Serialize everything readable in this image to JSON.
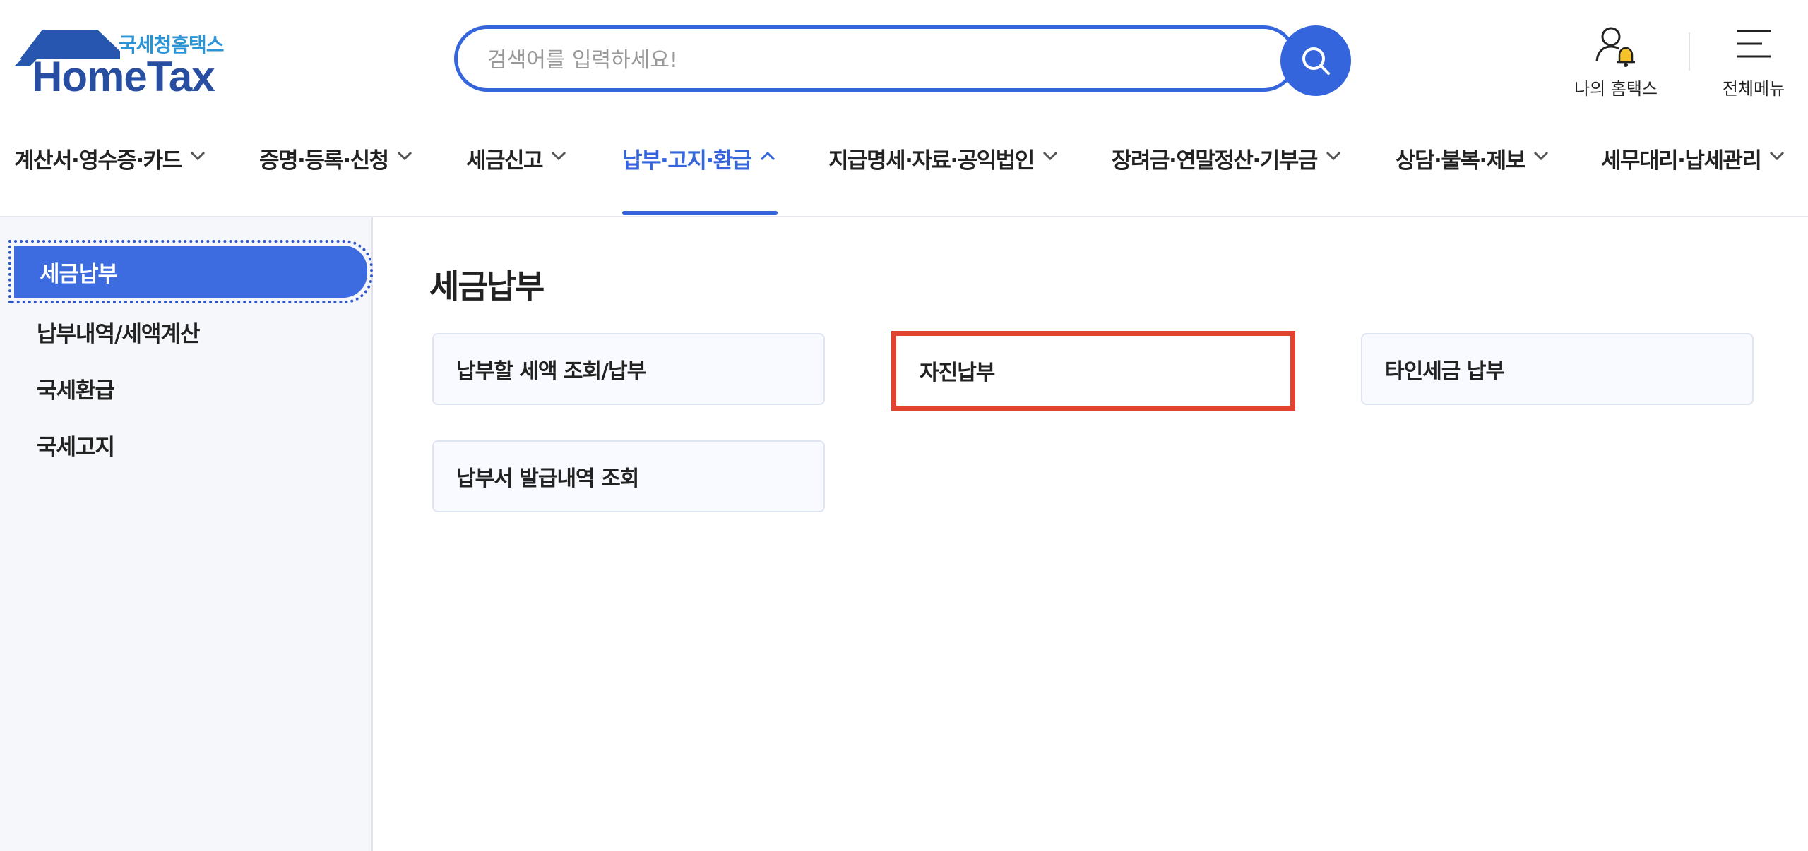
{
  "header": {
    "logo_korean": "국세청홈택스",
    "logo_english": "HomeTax",
    "search": {
      "placeholder": "검색어를 입력하세요!",
      "value": ""
    },
    "my_hometax_label": "나의 홈택스",
    "all_menu_label": "전체메뉴"
  },
  "gnb": {
    "items": [
      {
        "label": "계산서·영수증·카드"
      },
      {
        "label": "증명·등록·신청"
      },
      {
        "label": "세금신고"
      },
      {
        "label": "납부·고지·환급",
        "active": true
      },
      {
        "label": "지급명세·자료·공익법인"
      },
      {
        "label": "장려금·연말정산·기부금"
      },
      {
        "label": "상담·불복·제보"
      },
      {
        "label": "세무대리·납세관리"
      }
    ]
  },
  "sidebar": {
    "items": [
      {
        "label": "세금납부",
        "active": true
      },
      {
        "label": "납부내역/세액계산"
      },
      {
        "label": "국세환급"
      },
      {
        "label": "국세고지"
      }
    ]
  },
  "main": {
    "title": "세금납부",
    "cards": [
      {
        "label": "납부할 세액 조회/납부"
      },
      {
        "label": "자진납부",
        "highlighted": true
      },
      {
        "label": "타인세금 납부"
      },
      {
        "label": "납부서 발급내역 조회"
      }
    ]
  },
  "colors": {
    "accent": "#3465dc",
    "logo_navy": "#274ea0",
    "highlight": "#e1432e",
    "sidebar_bg": "#f5f7fb"
  }
}
